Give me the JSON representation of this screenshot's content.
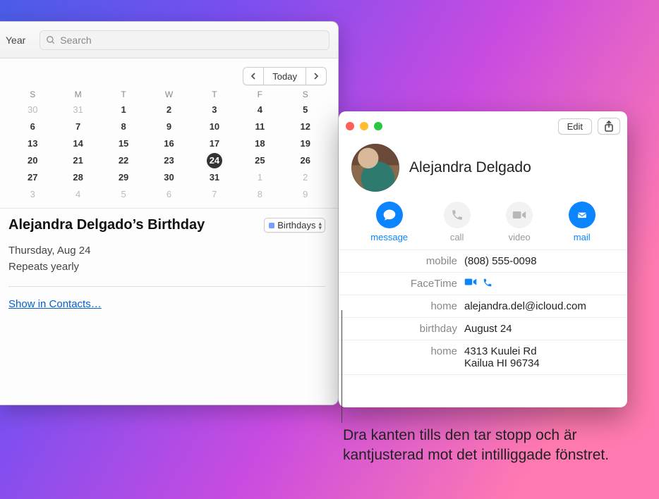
{
  "calendar": {
    "year_label": "Year",
    "search_placeholder": "Search",
    "today_label": "Today",
    "weekday_heads": [
      "S",
      "M",
      "T",
      "W",
      "T",
      "F",
      "S"
    ],
    "grid": [
      {
        "d": "30",
        "dim": true
      },
      {
        "d": "31",
        "dim": true
      },
      {
        "d": "1",
        "bold": true
      },
      {
        "d": "2",
        "bold": true
      },
      {
        "d": "3",
        "bold": true
      },
      {
        "d": "4",
        "bold": true
      },
      {
        "d": "5",
        "bold": true
      },
      {
        "d": "6",
        "bold": true
      },
      {
        "d": "7",
        "bold": true
      },
      {
        "d": "8",
        "bold": true
      },
      {
        "d": "9",
        "bold": true
      },
      {
        "d": "10",
        "bold": true
      },
      {
        "d": "11",
        "bold": true
      },
      {
        "d": "12",
        "bold": true
      },
      {
        "d": "13",
        "bold": true
      },
      {
        "d": "14",
        "bold": true
      },
      {
        "d": "15",
        "bold": true
      },
      {
        "d": "16",
        "bold": true
      },
      {
        "d": "17",
        "bold": true
      },
      {
        "d": "18",
        "bold": true
      },
      {
        "d": "19",
        "bold": true
      },
      {
        "d": "20",
        "bold": true
      },
      {
        "d": "21",
        "bold": true
      },
      {
        "d": "22",
        "bold": true
      },
      {
        "d": "23",
        "bold": true
      },
      {
        "d": "24",
        "bold": true,
        "today": true
      },
      {
        "d": "25",
        "bold": true
      },
      {
        "d": "26",
        "bold": true
      },
      {
        "d": "27",
        "bold": true
      },
      {
        "d": "28",
        "bold": true
      },
      {
        "d": "29",
        "bold": true
      },
      {
        "d": "30",
        "bold": true
      },
      {
        "d": "31",
        "bold": true
      },
      {
        "d": "1",
        "dim": true
      },
      {
        "d": "2",
        "dim": true
      },
      {
        "d": "3",
        "dim": true
      },
      {
        "d": "4",
        "dim": true
      },
      {
        "d": "5",
        "dim": true
      },
      {
        "d": "6",
        "dim": true
      },
      {
        "d": "7",
        "dim": true
      },
      {
        "d": "8",
        "dim": true
      },
      {
        "d": "9",
        "dim": true
      }
    ],
    "event": {
      "title": "Alejandra Delgado’s Birthday",
      "tag_label": "Birthdays",
      "date": "Thursday, Aug 24",
      "repeat": "Repeats yearly",
      "show_link": "Show in Contacts…"
    }
  },
  "contacts": {
    "edit_label": "Edit",
    "name": "Alejandra Delgado",
    "actions": {
      "message": "message",
      "call": "call",
      "video": "video",
      "mail": "mail"
    },
    "rows": {
      "mobile_k": "mobile",
      "mobile_v": "(808) 555-0098",
      "facetime_k": "FaceTime",
      "home_email_k": "home",
      "home_email_v": "alejandra.del@icloud.com",
      "birthday_k": "birthday",
      "birthday_v": "August 24",
      "home_addr_k": "home",
      "home_addr_l1": "4313 Kuulei Rd",
      "home_addr_l2": "Kailua HI 96734"
    }
  },
  "callout": {
    "text": "Dra kanten tills den tar stopp och är kantjusterad mot det intilliggade fönstret."
  }
}
